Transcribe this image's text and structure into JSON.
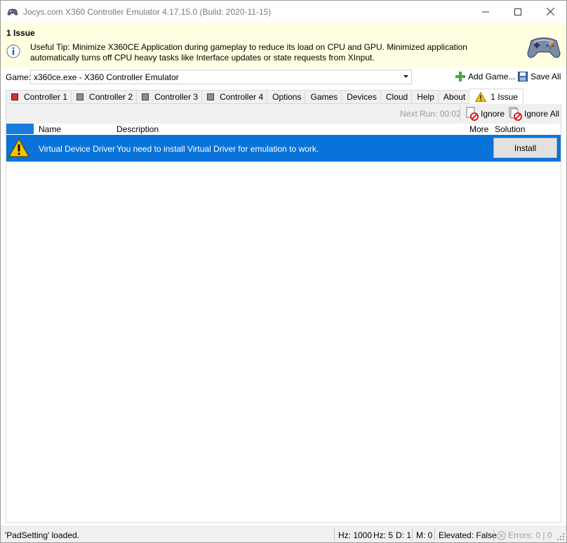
{
  "window": {
    "title": "Jocys.com X360 Controller Emulator 4.17.15.0 (Build: 2020-11-15)"
  },
  "tip": {
    "title": "1 Issue",
    "text": "Useful Tip: Minimize X360CE Application during gameplay to reduce its load on CPU and GPU. Minimized application automatically turns off CPU heavy tasks like Interface updates or state requests from XInput."
  },
  "game": {
    "label": "Game:",
    "selected": "x360ce.exe - X360 Controller Emulator",
    "add_label": "Add Game...",
    "save_label": "Save All"
  },
  "tabs": [
    {
      "label": "Controller 1",
      "icon": "controller-red-icon"
    },
    {
      "label": "Controller 2",
      "icon": "controller-gray-icon"
    },
    {
      "label": "Controller 3",
      "icon": "controller-gray-icon"
    },
    {
      "label": "Controller 4",
      "icon": "controller-gray-icon"
    },
    {
      "label": "Options"
    },
    {
      "label": "Games"
    },
    {
      "label": "Devices"
    },
    {
      "label": "Cloud"
    },
    {
      "label": "Help"
    },
    {
      "label": "About"
    },
    {
      "label": "1 Issue",
      "icon": "warning-icon",
      "active": true
    }
  ],
  "toolbar": {
    "next_run": "Next Run: 00:02",
    "ignore_label": "Ignore",
    "ignore_all_label": "Ignore All"
  },
  "grid": {
    "columns": [
      "Name",
      "Description",
      "More",
      "Solution"
    ],
    "rows": [
      {
        "name": "Virtual Device Driver",
        "description": "You need to install Virtual Driver for emulation to work.",
        "more": "",
        "solution": "Install"
      }
    ]
  },
  "status": {
    "message": "'PadSetting' loaded.",
    "hz": "Hz: 1000",
    "hz2": "Hz: 5",
    "d": "D: 1",
    "m": "M: 0",
    "elevated": "Elevated: False",
    "errors": "Errors: 0 | 0"
  },
  "colors": {
    "selection": "#0a73d9",
    "tip_background": "#ffffe1"
  }
}
